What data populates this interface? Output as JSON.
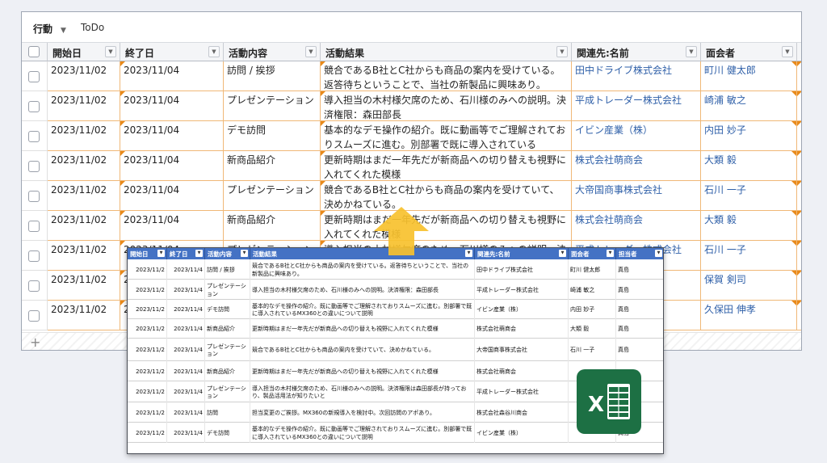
{
  "tabs": {
    "active": "行動",
    "caret": "▼",
    "todo": "ToDo"
  },
  "grid": {
    "headers": [
      "開始日",
      "終了日",
      "活動内容",
      "活動結果",
      "関連先:名前",
      "面会者",
      "担当者"
    ],
    "rows": [
      [
        "2023/11/02",
        "2023/11/04",
        "訪問 / 挨拶",
        "競合であるB社とC社からも商品の案内を受けている。返答待ちということで、当社の新製品に興味あり。",
        "田中ドライブ株式会社",
        "町川 健太郎"
      ],
      [
        "2023/11/02",
        "2023/11/04",
        "プレゼンテーション",
        "導入担当の木村様欠席のため、石川様のみへの説明。決済権限：森田部長",
        "平成トレーダー株式会社",
        "崎浦 敏之"
      ],
      [
        "2023/11/02",
        "2023/11/04",
        "デモ訪問",
        "基本的なデモ操作の紹介。既に動画等でご理解されておりスムーズに進む。別部署で既に導入されているMX360との",
        "イビン産業（株）",
        "内田 妙子"
      ],
      [
        "2023/11/02",
        "2023/11/04",
        "新商品紹介",
        "更新時期はまだ一年先だが新商品への切り替えも視野に入れてくれた模様",
        "株式会社萌商会",
        "大類 毅"
      ],
      [
        "2023/11/02",
        "2023/11/04",
        "プレゼンテーション",
        "競合であるB社とC社からも商品の案内を受けていて、決めかねている。",
        "大帝国商事株式会社",
        "石川 一子"
      ],
      [
        "2023/11/02",
        "2023/11/04",
        "新商品紹介",
        "更新時期はまだ一年先だが新商品への切り替えも視野に入れてくれた模様",
        "株式会社萌商会",
        "大類 毅"
      ],
      [
        "2023/11/02",
        "2023/11/04",
        "プレゼンテーション",
        "導入担当の木村様欠席のため、石川様のみへの説明。決済",
        "平成トレーダー株式会社",
        "石川 一子"
      ],
      [
        "2023/11/02",
        "2023/11/04",
        "",
        "",
        "",
        "保賀 剣司"
      ],
      [
        "2023/11/02",
        "2023/11/04",
        "",
        "",
        "",
        "久保田 伸孝"
      ]
    ],
    "add_label": "+"
  },
  "excel": {
    "headers": [
      "開始日",
      "終了日",
      "活動内容",
      "活動結果",
      "関連先:名前",
      "面会者",
      "担当者"
    ],
    "rows": [
      [
        "2023/11/2",
        "2023/11/4",
        "訪問 / 挨拶",
        "競合であるB社とC社からも商品の案内を受けている。返答待ちということで、当社の新製品に興味あり。",
        "田中ドライブ株式会社",
        "町川 健太郎",
        "真島"
      ],
      [
        "2023/11/2",
        "2023/11/4",
        "プレゼンテーション",
        "導入担当の木村様欠席のため、石川様のみへの説明。決済権限：森田部長",
        "平成トレーダー株式会社",
        "崎浦 敏之",
        "真島"
      ],
      [
        "2023/11/2",
        "2023/11/4",
        "デモ訪問",
        "基本的なデモ操作の紹介。既に動画等でご理解されておりスムーズに進む。別部署で既に導入されているMX360との違いについて説明",
        "イビン産業（株）",
        "内田 妙子",
        "真島"
      ],
      [
        "2023/11/2",
        "2023/11/4",
        "新商品紹介",
        "更新時期はまだ一年先だが新商品への切り替えも視野に入れてくれた模様",
        "株式会社萌商会",
        "大類 毅",
        "真島"
      ],
      [
        "2023/11/2",
        "2023/11/4",
        "プレゼンテーション",
        "競合であるB社とC社からも商品の案内を受けていて、決めかねている。",
        "大帝国商事株式会社",
        "石川 一子",
        "真島"
      ],
      [
        "2023/11/2",
        "2023/11/4",
        "新商品紹介",
        "更新時期はまだ一年先だが新商品への切り替えも視野に入れてくれた模様",
        "株式会社萌商会",
        "",
        ""
      ],
      [
        "2023/11/2",
        "2023/11/4",
        "プレゼンテーション",
        "導入担当の木村様欠席のため、石川様のみへの説明。決済権限は森田部長が持っており、製品活用法が知りたいと",
        "平成トレーダー株式会社",
        "",
        ""
      ],
      [
        "2023/11/2",
        "2023/11/4",
        "訪問",
        "担当変更のご挨拶。MX360の新規導入を検討中。次回訪問のアポあり。",
        "株式会社森谷川商会",
        "",
        ""
      ],
      [
        "2023/11/2",
        "2023/11/4",
        "デモ訪問",
        "基本的なデモ操作の紹介。既に動画等でご理解されておりスムーズに進む。別部署で既に導入されているMX360との違いについて説明",
        "イビン産業（株）",
        "",
        "真島"
      ]
    ]
  },
  "colors": {
    "accent": "#e98a1a",
    "link": "#2e5fa8",
    "excel_header": "#4472c4",
    "excel_green": "#1d7044",
    "arrow": "#f7c12e"
  },
  "icons": {
    "excel": "excel-logo-icon",
    "arrow": "up-arrow-icon"
  },
  "logo_letter": "X"
}
